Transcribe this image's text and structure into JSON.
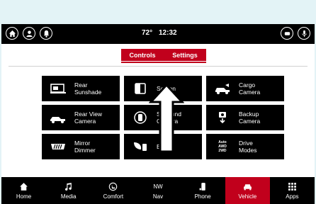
{
  "status": {
    "temperature": "72°",
    "time": "12:32"
  },
  "tabs": [
    {
      "label": "Controls"
    },
    {
      "label": "Settings"
    }
  ],
  "tiles": [
    {
      "label": "Rear\nSunshade",
      "icon": "sunshade-icon"
    },
    {
      "label": "Screen",
      "icon": "screen-off-icon"
    },
    {
      "label": "Cargo\nCamera",
      "icon": "cargo-camera-icon"
    },
    {
      "label": "Rear View\nCamera",
      "icon": "rear-camera-icon"
    },
    {
      "label": "Surround\nCamera",
      "icon": "surround-camera-icon"
    },
    {
      "label": "Backup\nCamera",
      "icon": "backup-camera-icon"
    },
    {
      "label": "Mirror\nDimmer",
      "icon": "mirror-dimmer-icon"
    },
    {
      "label": "Eco",
      "icon": "eco-icon"
    },
    {
      "label": "Drive\nModes",
      "icon": "drive-modes-icon",
      "icon_text": [
        "Auto",
        "AWD",
        "2WD"
      ]
    }
  ],
  "nav": [
    {
      "label": "Home",
      "icon": "home-icon"
    },
    {
      "label": "Media",
      "icon": "music-note-icon"
    },
    {
      "label": "Comfort",
      "icon": "seat-icon"
    },
    {
      "label": "Nav",
      "icon": "compass-icon",
      "icon_text": "NW"
    },
    {
      "label": "Phone",
      "icon": "phone-icon"
    },
    {
      "label": "Vehicle",
      "icon": "car-icon",
      "active": true
    },
    {
      "label": "Apps",
      "icon": "apps-grid-icon"
    }
  ],
  "colors": {
    "accent": "#c1001c",
    "background": "#000000",
    "panel": "#ffffff"
  }
}
